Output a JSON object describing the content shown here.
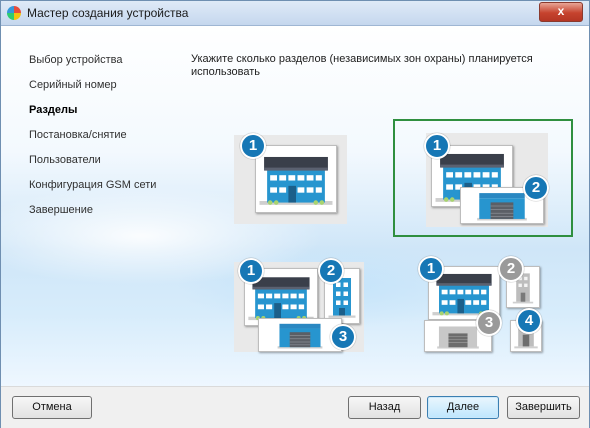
{
  "window": {
    "title": "Мастер создания устройства",
    "close_label": "x"
  },
  "sidebar": {
    "items": [
      {
        "label": "Выбор устройства",
        "active": false
      },
      {
        "label": "Серийный номер",
        "active": false
      },
      {
        "label": "Разделы",
        "active": true
      },
      {
        "label": "Постановка/снятие",
        "active": false
      },
      {
        "label": "Пользователи",
        "active": false
      },
      {
        "label": "Конфигурация GSM сети",
        "active": false
      },
      {
        "label": "Завершение",
        "active": false
      }
    ]
  },
  "instruction": "Укажите сколько разделов (независимых зон охраны) планируется использовать",
  "options": [
    {
      "count": 1,
      "selected": false,
      "badges": [
        "1"
      ]
    },
    {
      "count": 2,
      "selected": true,
      "badges": [
        "1",
        "2"
      ]
    },
    {
      "count": 3,
      "selected": false,
      "badges": [
        "1",
        "2",
        "3"
      ]
    },
    {
      "count": 4,
      "selected": false,
      "badges": [
        "1",
        "2",
        "3",
        "4"
      ]
    }
  ],
  "footer": {
    "cancel": "Отмена",
    "back": "Назад",
    "next": "Далее",
    "finish": "Завершить"
  },
  "colors": {
    "selected_border": "#2f8f3f",
    "badge_blue": "#1677b5",
    "badge_gray": "#9a9a9a",
    "building_blue": "#2795cf"
  }
}
